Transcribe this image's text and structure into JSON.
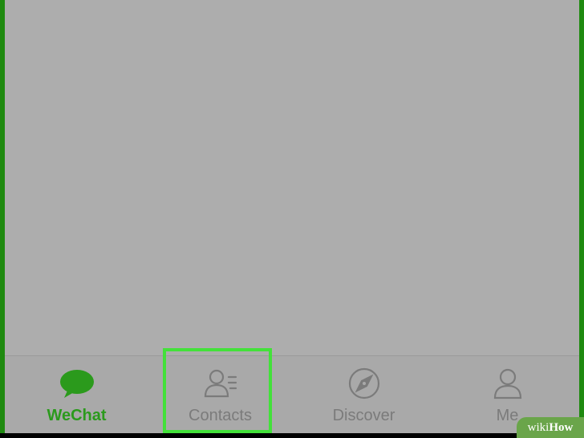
{
  "tabs": [
    {
      "label": "WeChat",
      "icon": "chat-bubble-icon",
      "active": true
    },
    {
      "label": "Contacts",
      "icon": "contacts-icon",
      "active": false
    },
    {
      "label": "Discover",
      "icon": "compass-icon",
      "active": false
    },
    {
      "label": "Me",
      "icon": "person-icon",
      "active": false
    }
  ],
  "colors": {
    "active": "#2b9a1c",
    "inactive": "#7b7b7b",
    "highlight": "#43e13a"
  },
  "watermark": {
    "prefix": "wiki",
    "suffix": "How"
  }
}
